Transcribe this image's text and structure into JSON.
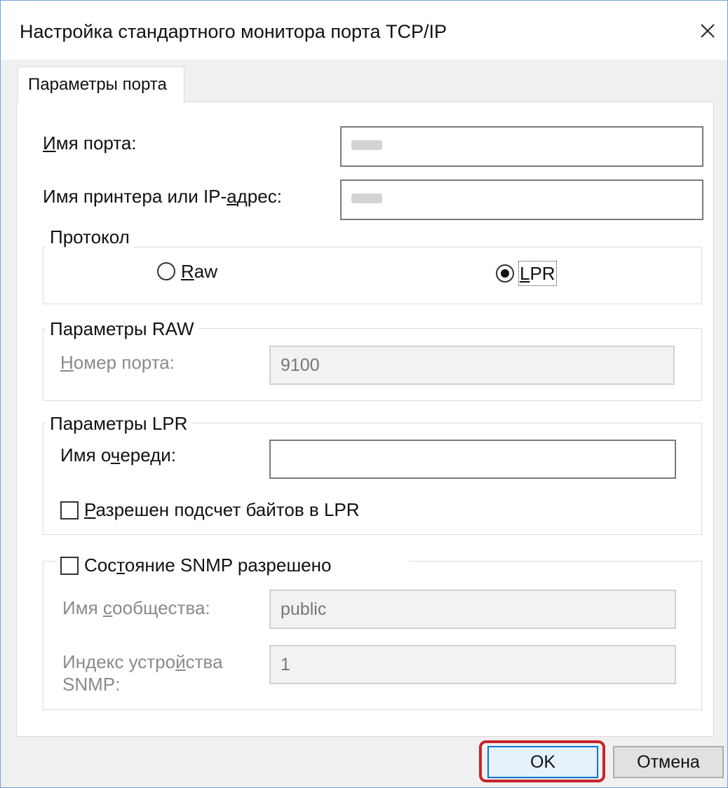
{
  "window": {
    "title": "Настройка стандартного монитора порта TCP/IP",
    "close_glyph": "✕"
  },
  "tabs": [
    {
      "label": "Параметры порта",
      "selected": true
    }
  ],
  "port": {
    "port_name_label_accel": "И",
    "port_name_label_rest": "мя порта:",
    "port_name_value": "",
    "printer_label_pre": "Имя принтера или IP-",
    "printer_label_accel": "а",
    "printer_label_rest": "дрес:",
    "printer_value": ""
  },
  "protocol": {
    "legend": "Протокол",
    "raw_accel": "R",
    "raw_rest": "aw",
    "lpr_accel": "L",
    "lpr_rest": "PR",
    "selected": "LPR"
  },
  "raw_settings": {
    "legend": "Параметры RAW",
    "port_number_accel": "Н",
    "port_number_rest": "омер порта:",
    "port_number_value": "9100"
  },
  "lpr_settings": {
    "legend": "Параметры LPR",
    "queue_label_pre": "Имя о",
    "queue_label_accel": "ч",
    "queue_label_rest": "ереди:",
    "queue_value": "",
    "byte_count_accel": "Р",
    "byte_count_rest": "азрешен подсчет байтов в LPR",
    "byte_count_checked": false
  },
  "snmp": {
    "enabled_pre": "Сос",
    "enabled_accel": "т",
    "enabled_rest": "ояние SNMP разрешено",
    "enabled_checked": false,
    "community_pre": "Имя ",
    "community_accel": "с",
    "community_rest": "ообщества:",
    "community_value": "public",
    "index_line1_pre": "Индекс устро",
    "index_line1_accel": "й",
    "index_line1_rest": "ства",
    "index_line2": "SNMP:",
    "index_value": "1"
  },
  "buttons": {
    "ok": "OK",
    "cancel": "Отмена"
  },
  "colors": {
    "accent": "#0078d7",
    "highlight_ring": "#c8242b",
    "window_border": "#6fa2d6"
  }
}
